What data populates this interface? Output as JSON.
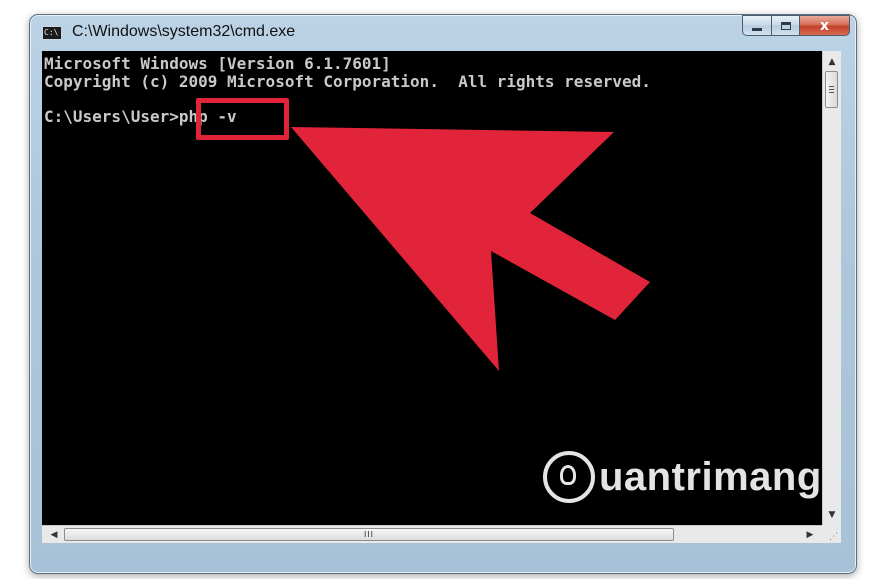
{
  "window": {
    "title": "C:\\Windows\\system32\\cmd.exe",
    "controls": {
      "minimize": "minimize",
      "maximize": "maximize",
      "close": "x"
    }
  },
  "console": {
    "lines": [
      "Microsoft Windows [Version 6.1.7601]",
      "Copyright (c) 2009 Microsoft Corporation.  All rights reserved.",
      "C:\\Users\\User>php -v"
    ]
  },
  "scrollbars": {
    "horizontal_thumb_grip": "III"
  },
  "overlay": {
    "highlight_color": "#e2243a",
    "arrow_color": "#e2243a",
    "highlighted_text": "php -v"
  },
  "watermark": {
    "text": "uantrimang",
    "logo": "lightbulb-q-icon"
  },
  "colors": {
    "console_bg": "#000000",
    "console_text": "#c9c9c9",
    "frame": "#aec7dd"
  }
}
